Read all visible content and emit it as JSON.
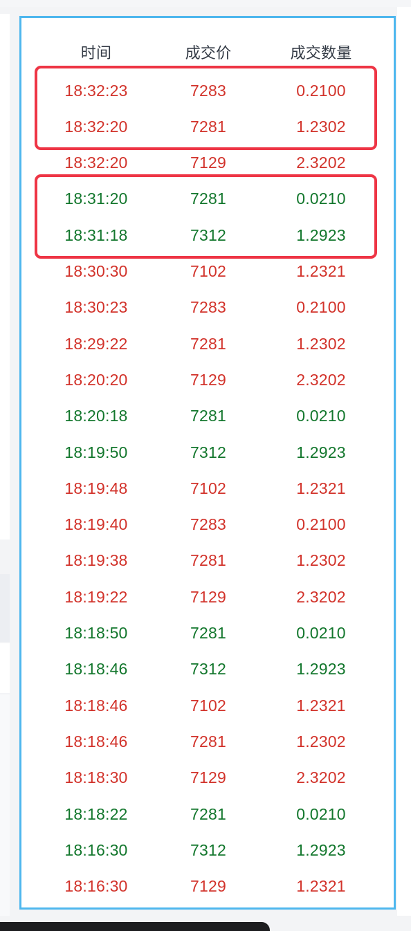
{
  "header": {
    "time_label": "时间",
    "price_label": "成交价",
    "qty_label": "成交数量"
  },
  "colors": {
    "panel_border": "#4eb7ee",
    "highlight_border": "#ee3545",
    "up_text": "#d2332b",
    "down_text": "#13772d",
    "header_text": "#333a45"
  },
  "trades": [
    {
      "time": "18:32:23",
      "price": "7283",
      "qty": "0.2100",
      "side": "up"
    },
    {
      "time": "18:32:20",
      "price": "7281",
      "qty": "1.2302",
      "side": "up"
    },
    {
      "time": "18:32:20",
      "price": "7129",
      "qty": "2.3202",
      "side": "up"
    },
    {
      "time": "18:31:20",
      "price": "7281",
      "qty": "0.0210",
      "side": "down"
    },
    {
      "time": "18:31:18",
      "price": "7312",
      "qty": "1.2923",
      "side": "down"
    },
    {
      "time": "18:30:30",
      "price": "7102",
      "qty": "1.2321",
      "side": "up"
    },
    {
      "time": "18:30:23",
      "price": "7283",
      "qty": "0.2100",
      "side": "up"
    },
    {
      "time": "18:29:22",
      "price": "7281",
      "qty": "1.2302",
      "side": "up"
    },
    {
      "time": "18:20:20",
      "price": "7129",
      "qty": "2.3202",
      "side": "up"
    },
    {
      "time": "18:20:18",
      "price": "7281",
      "qty": "0.0210",
      "side": "down"
    },
    {
      "time": "18:19:50",
      "price": "7312",
      "qty": "1.2923",
      "side": "down"
    },
    {
      "time": "18:19:48",
      "price": "7102",
      "qty": "1.2321",
      "side": "up"
    },
    {
      "time": "18:19:40",
      "price": "7283",
      "qty": "0.2100",
      "side": "up"
    },
    {
      "time": "18:19:38",
      "price": "7281",
      "qty": "1.2302",
      "side": "up"
    },
    {
      "time": "18:19:22",
      "price": "7129",
      "qty": "2.3202",
      "side": "up"
    },
    {
      "time": "18:18:50",
      "price": "7281",
      "qty": "0.0210",
      "side": "down"
    },
    {
      "time": "18:18:46",
      "price": "7312",
      "qty": "1.2923",
      "side": "down"
    },
    {
      "time": "18:18:46",
      "price": "7102",
      "qty": "1.2321",
      "side": "up"
    },
    {
      "time": "18:18:46",
      "price": "7281",
      "qty": "1.2302",
      "side": "up"
    },
    {
      "time": "18:18:30",
      "price": "7129",
      "qty": "2.3202",
      "side": "up"
    },
    {
      "time": "18:18:22",
      "price": "7281",
      "qty": "0.0210",
      "side": "down"
    },
    {
      "time": "18:16:30",
      "price": "7312",
      "qty": "1.2923",
      "side": "down"
    },
    {
      "time": "18:16:30",
      "price": "7129",
      "qty": "1.2321",
      "side": "up"
    }
  ]
}
